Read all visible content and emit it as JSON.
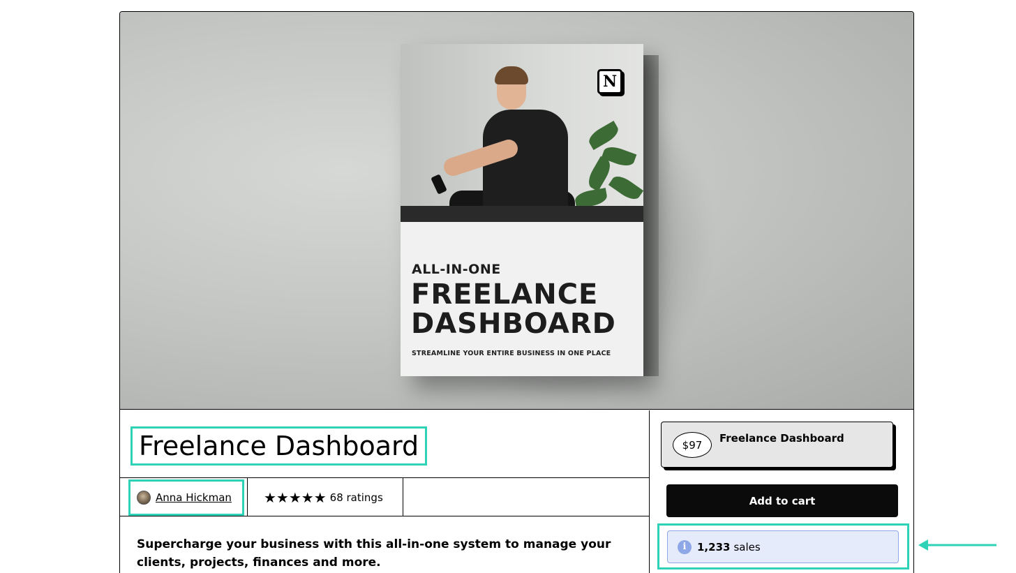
{
  "hero": {
    "box_kicker": "ALL-IN-ONE",
    "box_title_line1": "FREELANCE",
    "box_title_line2": "DASHBOARD",
    "box_tagline": "STREAMLINE YOUR ENTIRE BUSINESS IN ONE PLACE",
    "logo_letter": "N"
  },
  "product": {
    "title": "Freelance Dashboard",
    "author": "Anna Hickman",
    "stars": "★★★★★",
    "ratings": "68 ratings",
    "description": "Supercharge your business with this all-in-one system to manage your clients, projects, finances and more."
  },
  "purchase": {
    "price": "$97",
    "variant_name": "Freelance Dashboard",
    "add_to_cart": "Add to cart",
    "info_glyph": "i",
    "sales_count": "1,233",
    "sales_label": "sales"
  },
  "colors": {
    "highlight": "#2ed3b7",
    "button": "#0b0b0b",
    "info_bg": "#e5ebfb",
    "info_accent": "#8ea7e6"
  },
  "icons": {
    "logo": "notion-logo",
    "info": "info-icon",
    "rating": "star-icon",
    "annotation": "arrow-left-icon"
  }
}
